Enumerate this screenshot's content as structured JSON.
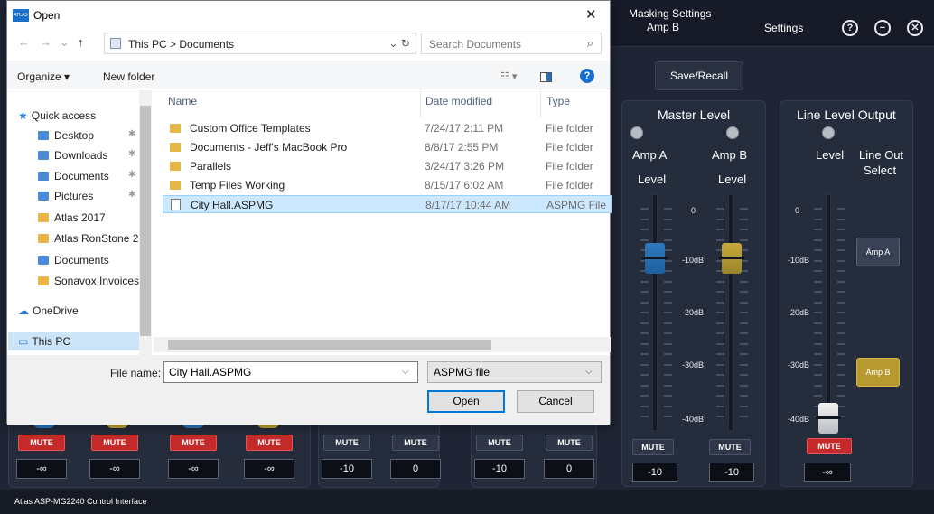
{
  "app": {
    "masking_title_1": "Masking Settings",
    "masking_title_2": "Amp B",
    "settings_label": "Settings",
    "help_glyph": "?",
    "minimize_glyph": "−",
    "close_glyph": "✕",
    "save_recall": "Save/Recall",
    "master_level": {
      "title": "Master Level",
      "amp_a": "Amp A",
      "amp_b": "Amp B",
      "level_a": "Level",
      "level_b": "Level",
      "scale": [
        "0",
        "-10dB",
        "-20dB",
        "-30dB",
        "-40dB"
      ],
      "mute_a": "MUTE",
      "mute_b": "MUTE",
      "value_a": "-10",
      "value_b": "-10"
    },
    "line_level": {
      "title": "Line Level Output",
      "level": "Level",
      "line_out_1": "Line Out",
      "line_out_2": "Select",
      "scale": [
        "0",
        "-10dB",
        "-20dB",
        "-30dB",
        "-40dB"
      ],
      "amp_a_button": "Amp A",
      "amp_b_button": "Amp B",
      "mute": "MUTE",
      "value": "-∞"
    },
    "channels": [
      {
        "mute": "MUTE",
        "value": "-∞"
      },
      {
        "mute": "MUTE",
        "value": "-∞"
      },
      {
        "mute": "MUTE",
        "value": "-∞"
      },
      {
        "mute": "MUTE",
        "value": "-∞"
      },
      {
        "mute": "MUTE",
        "value": "-10"
      },
      {
        "mute": "MUTE",
        "value": "0"
      },
      {
        "mute": "MUTE",
        "value": "-10"
      },
      {
        "mute": "MUTE",
        "value": "0"
      }
    ],
    "status": "Atlas ASP-MG2240 Control Interface"
  },
  "dialog": {
    "title": "Open",
    "app_icon_text": "ATLAS",
    "close_glyph": "✕",
    "nav": {
      "back": "←",
      "forward": "→",
      "recent": "⌄",
      "up": "↑"
    },
    "breadcrumb": "This PC  >  Documents",
    "breadcrumb_chevron": ">",
    "addr_controls": "⌄  ↻",
    "search_placeholder": "Search Documents",
    "search_icon_glyph": "⌕",
    "toolbar": {
      "organize": "Organize ▾",
      "new_folder": "New folder",
      "view_glyph": "☷ ▾",
      "help_glyph": "?"
    },
    "navpane": [
      {
        "label": "Quick access",
        "icon": "star-icon"
      },
      {
        "label": "Desktop",
        "icon": "desktop-folder-icon",
        "pinned": true
      },
      {
        "label": "Downloads",
        "icon": "downloads-folder-icon",
        "pinned": true
      },
      {
        "label": "Documents",
        "icon": "documents-folder-icon",
        "pinned": true
      },
      {
        "label": "Pictures",
        "icon": "pictures-folder-icon",
        "pinned": true
      },
      {
        "label": "Atlas 2017",
        "icon": "folder-icon"
      },
      {
        "label": "Atlas RonStone 2",
        "icon": "folder-icon"
      },
      {
        "label": "Documents",
        "icon": "documents-folder-icon"
      },
      {
        "label": "Sonavox Invoices",
        "icon": "folder-icon"
      },
      {
        "label": "OneDrive",
        "icon": "cloud-icon"
      },
      {
        "label": "This PC",
        "icon": "computer-icon",
        "selected": true
      }
    ],
    "pin_glyph": "✱",
    "columns": {
      "name": "Name",
      "date": "Date modified",
      "type": "Type"
    },
    "files": [
      {
        "name": "Custom Office Templates",
        "date": "7/24/17 2:11 PM",
        "type": "File folder",
        "kind": "folder"
      },
      {
        "name": "Documents - Jeff's MacBook Pro",
        "date": "8/8/17 2:55 PM",
        "type": "File folder",
        "kind": "folder"
      },
      {
        "name": "Parallels",
        "date": "3/24/17 3:26 PM",
        "type": "File folder",
        "kind": "folder"
      },
      {
        "name": "Temp Files Working",
        "date": "8/15/17 6:02 AM",
        "type": "File folder",
        "kind": "folder"
      },
      {
        "name": "City Hall.ASPMG",
        "date": "8/17/17 10:44 AM",
        "type": "ASPMG File",
        "kind": "file",
        "selected": true
      }
    ],
    "file_name_label": "File name:",
    "file_name_value": "City Hall.ASPMG",
    "file_type_value": "ASPMG file",
    "open_button": "Open",
    "cancel_button": "Cancel"
  },
  "colors": {
    "app_bg": "#1f2534",
    "mute_red": "#c42a2a",
    "fader_blue": "#2e79bd",
    "fader_gold": "#c6aa3a",
    "selection": "#cce8ff",
    "accent": "#0078d7"
  }
}
